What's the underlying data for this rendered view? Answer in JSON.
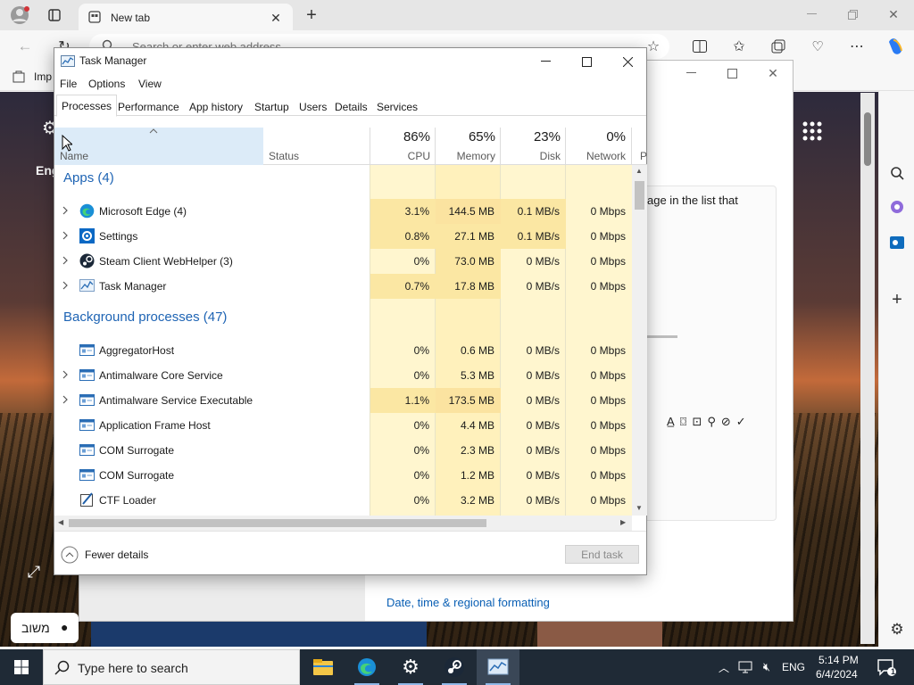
{
  "browser": {
    "tab_title": "New tab",
    "address_placeholder": "Search or enter web address",
    "favorites_item": "Imp",
    "ntp_left_text": "Eng",
    "ntp_lang_badge": "משוב"
  },
  "settings_window": {
    "partial_text": "age in the list that",
    "link_text": "Date, time & regional formatting"
  },
  "task_manager": {
    "title": "Task Manager",
    "menu": [
      "File",
      "Options",
      "View"
    ],
    "tabs": [
      "Processes",
      "Performance",
      "App history",
      "Startup",
      "Users",
      "Details",
      "Services"
    ],
    "active_tab": "Processes",
    "columns": {
      "name": "Name",
      "status": "Status",
      "cpu": {
        "pct": "86%",
        "label": "CPU"
      },
      "memory": {
        "pct": "65%",
        "label": "Memory"
      },
      "disk": {
        "pct": "23%",
        "label": "Disk"
      },
      "network": {
        "pct": "0%",
        "label": "Network"
      },
      "power_partial": "P"
    },
    "apps_group": "Apps (4)",
    "apps": [
      {
        "name": "Microsoft Edge (4)",
        "cpu": "3.1%",
        "memory": "144.5 MB",
        "disk": "0.1 MB/s",
        "network": "0 Mbps",
        "expandable": true,
        "icon": "edge-icon"
      },
      {
        "name": "Settings",
        "cpu": "0.8%",
        "memory": "27.1 MB",
        "disk": "0.1 MB/s",
        "network": "0 Mbps",
        "expandable": true,
        "icon": "settings-gear-icon"
      },
      {
        "name": "Steam Client WebHelper (3)",
        "cpu": "0%",
        "memory": "73.0 MB",
        "disk": "0 MB/s",
        "network": "0 Mbps",
        "expandable": true,
        "icon": "steam-icon"
      },
      {
        "name": "Task Manager",
        "cpu": "0.7%",
        "memory": "17.8 MB",
        "disk": "0 MB/s",
        "network": "0 Mbps",
        "expandable": true,
        "icon": "task-manager-icon"
      }
    ],
    "background_group": "Background processes (47)",
    "background": [
      {
        "name": "AggregatorHost",
        "cpu": "0%",
        "memory": "0.6 MB",
        "disk": "0 MB/s",
        "network": "0 Mbps",
        "expandable": false,
        "icon": "service-icon"
      },
      {
        "name": "Antimalware Core Service",
        "cpu": "0%",
        "memory": "5.3 MB",
        "disk": "0 MB/s",
        "network": "0 Mbps",
        "expandable": true,
        "icon": "service-icon"
      },
      {
        "name": "Antimalware Service Executable",
        "cpu": "1.1%",
        "memory": "173.5 MB",
        "disk": "0 MB/s",
        "network": "0 Mbps",
        "expandable": true,
        "icon": "service-icon"
      },
      {
        "name": "Application Frame Host",
        "cpu": "0%",
        "memory": "4.4 MB",
        "disk": "0 MB/s",
        "network": "0 Mbps",
        "expandable": false,
        "icon": "service-icon"
      },
      {
        "name": "COM Surrogate",
        "cpu": "0%",
        "memory": "2.3 MB",
        "disk": "0 MB/s",
        "network": "0 Mbps",
        "expandable": false,
        "icon": "service-icon"
      },
      {
        "name": "COM Surrogate",
        "cpu": "0%",
        "memory": "1.2 MB",
        "disk": "0 MB/s",
        "network": "0 Mbps",
        "expandable": false,
        "icon": "service-icon"
      },
      {
        "name": "CTF Loader",
        "cpu": "0%",
        "memory": "3.2 MB",
        "disk": "0 MB/s",
        "network": "0 Mbps",
        "expandable": false,
        "icon": "ctf-loader-icon"
      }
    ],
    "footer": {
      "fewer_details": "Fewer details",
      "end_task": "End task"
    }
  },
  "taskbar": {
    "search_placeholder": "Type here to search",
    "language": "ENG",
    "time": "5:14 PM",
    "date": "6/4/2024",
    "notification_count": "1"
  },
  "colors": {
    "accent_blue": "#1e64b4",
    "heat_light": "#fff4c4",
    "heat_medium": "#fbe8a6",
    "header_selected": "#dcebf8",
    "taskbar": "#1f2a36"
  }
}
